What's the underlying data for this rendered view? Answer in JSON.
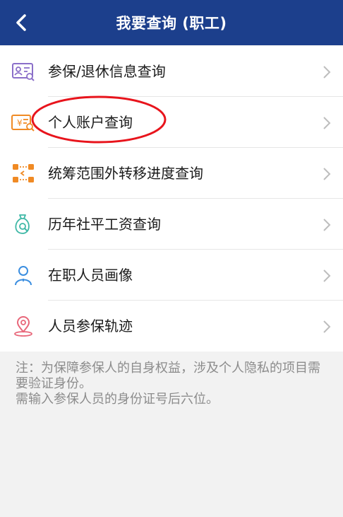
{
  "header": {
    "title": "我要查询 (职工)",
    "back_icon": "chevron-left-icon"
  },
  "menu": {
    "items": [
      {
        "label": "参保/退休信息查询",
        "icon": "id-card-search-icon",
        "color": "#8b6fc9"
      },
      {
        "label": "个人账户查询",
        "icon": "yuan-account-icon",
        "color": "#f08a24"
      },
      {
        "label": "统筹范围外转移进度查询",
        "icon": "transfer-icon",
        "color": "#f08a24"
      },
      {
        "label": "历年社平工资查询",
        "icon": "money-bag-search-icon",
        "color": "#3fb8a6"
      },
      {
        "label": "在职人员画像",
        "icon": "person-icon",
        "color": "#3b8ee0"
      },
      {
        "label": "人员参保轨迹",
        "icon": "location-pin-icon",
        "color": "#e8677a"
      }
    ],
    "chevron_icon": "chevron-right-icon"
  },
  "annotation": {
    "color": "#e8141c",
    "shape": "ellipse",
    "target": "个人账户查询"
  },
  "note": {
    "line1": "注：为保障参保人的自身权益，涉及个人隐私的项目需要验证身份。",
    "line2": "需输入参保人员的身份证号后六位。"
  },
  "colors": {
    "header_bg": "#1c3f8c",
    "page_bg": "#f2f2f2"
  }
}
